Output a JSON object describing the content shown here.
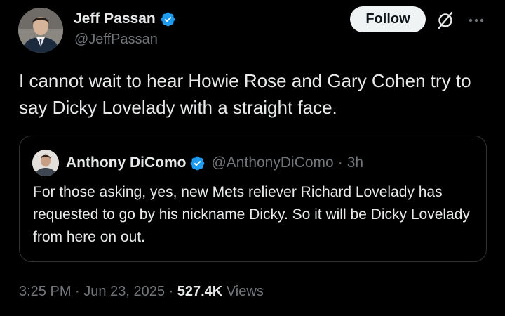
{
  "author": {
    "name": "Jeff Passan",
    "handle": "@JeffPassan"
  },
  "actions": {
    "follow_label": "Follow"
  },
  "tweet": {
    "text": "I cannot wait to hear Howie Rose and Gary Cohen try to say Dicky Lovelady with a straight face."
  },
  "quote": {
    "name": "Anthony DiComo",
    "handle": "@AnthonyDiComo",
    "separator": "·",
    "time": "3h",
    "text": "For those asking, yes, new Mets reliever Richard Lovelady has requested to go by his nickname Dicky. So it will be Dicky Lovelady from here on out."
  },
  "meta": {
    "time": "3:25 PM",
    "sep1": "·",
    "date": "Jun 23, 2025",
    "sep2": "·",
    "views_count": "527.4K",
    "views_label": "Views"
  },
  "icons": {
    "verified": "verified-badge-icon",
    "grok": "grok-icon",
    "more": "more-icon"
  },
  "colors": {
    "background": "#000000",
    "text": "#e7e9ea",
    "secondary": "#71767b",
    "verified": "#1d9bf0",
    "border": "#2f3336",
    "follow_bg": "#eff3f4"
  }
}
